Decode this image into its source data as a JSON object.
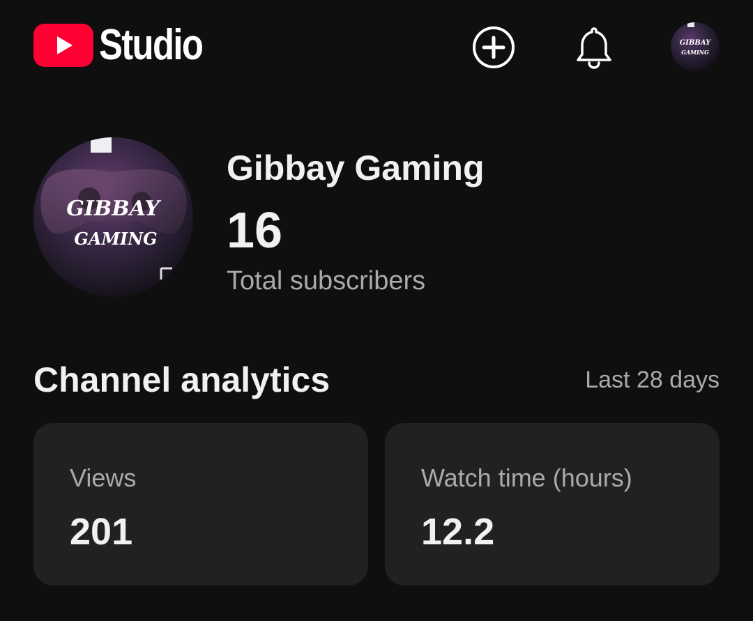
{
  "header": {
    "brand_label": "Studio",
    "icons": {
      "logo": "youtube-logo-icon",
      "create": "create-plus-icon",
      "notifications": "bell-icon"
    },
    "colors": {
      "brand_red": "#ff0033",
      "background": "#0f0f0f",
      "card": "#212121",
      "text_primary": "#f1f1f1",
      "text_secondary": "#aaaaaa"
    }
  },
  "channel": {
    "name": "Gibbay Gaming",
    "subscriber_count": "16",
    "subscriber_label": "Total subscribers",
    "logo_text_line1": "GIBBAY",
    "logo_text_line2": "GAMING"
  },
  "analytics": {
    "title": "Channel analytics",
    "period": "Last 28 days",
    "cards": [
      {
        "label": "Views",
        "value": "201"
      },
      {
        "label": "Watch time (hours)",
        "value": "12.2"
      }
    ]
  }
}
